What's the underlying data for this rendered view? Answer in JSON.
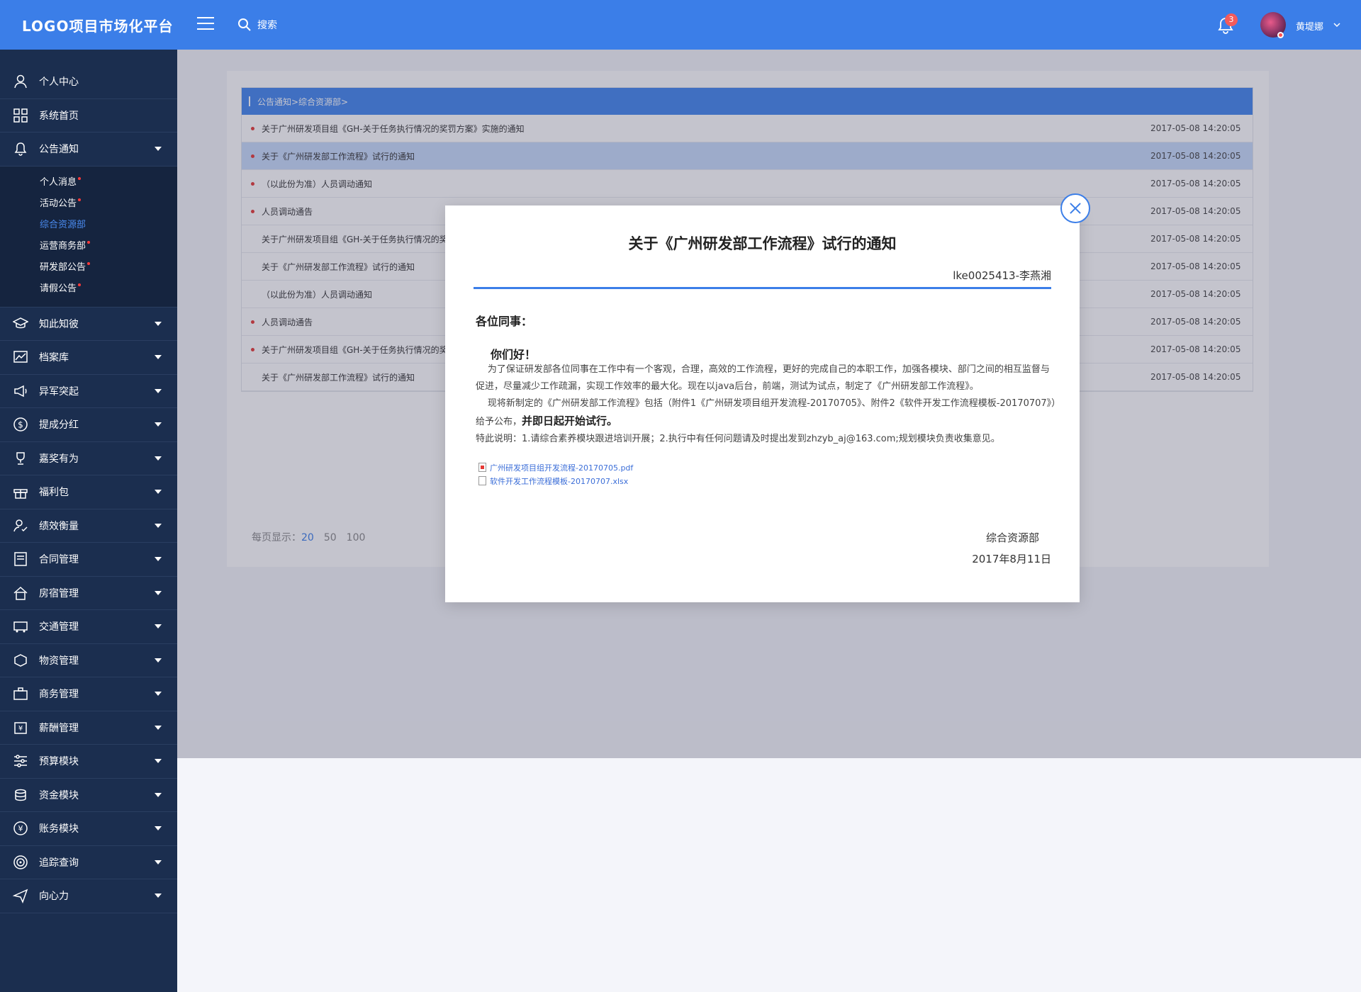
{
  "header": {
    "logo": "LOGO项目市场化平台",
    "search_label": "搜索",
    "notification_count": "3",
    "username": "黄堤娜"
  },
  "sidebar": {
    "items": [
      {
        "label": "个人中心",
        "icon": "user-icon"
      },
      {
        "label": "系统首页",
        "icon": "grid-icon"
      },
      {
        "label": "公告通知",
        "icon": "bell-icon",
        "expanded": true
      },
      {
        "label": "知此知彼",
        "icon": "graduation-cap-icon"
      },
      {
        "label": "档案库",
        "icon": "chart-icon"
      },
      {
        "label": "异军突起",
        "icon": "megaphone-icon"
      },
      {
        "label": "提成分红",
        "icon": "dollar-icon"
      },
      {
        "label": "嘉奖有为",
        "icon": "trophy-icon"
      },
      {
        "label": "福利包",
        "icon": "gift-icon"
      },
      {
        "label": "绩效衡量",
        "icon": "user-check-icon"
      },
      {
        "label": "合同管理",
        "icon": "contract-icon"
      },
      {
        "label": "房宿管理",
        "icon": "home-icon"
      },
      {
        "label": "交通管理",
        "icon": "bus-icon"
      },
      {
        "label": "物资管理",
        "icon": "box-icon"
      },
      {
        "label": "商务管理",
        "icon": "briefcase-icon"
      },
      {
        "label": "薪酬管理",
        "icon": "money-icon"
      },
      {
        "label": "预算模块",
        "icon": "sliders-icon"
      },
      {
        "label": "资金模块",
        "icon": "coins-icon"
      },
      {
        "label": "账务模块",
        "icon": "yen-icon"
      },
      {
        "label": "追踪查询",
        "icon": "target-icon"
      },
      {
        "label": "向心力",
        "icon": "send-icon"
      }
    ],
    "sub_items": [
      {
        "label": "个人消息",
        "dot": true,
        "active": false
      },
      {
        "label": "活动公告",
        "dot": true,
        "active": false
      },
      {
        "label": "综合资源部",
        "dot": false,
        "active": true
      },
      {
        "label": "运营商务部",
        "dot": true,
        "active": false
      },
      {
        "label": "研发部公告",
        "dot": true,
        "active": false
      },
      {
        "label": "请假公告",
        "dot": true,
        "active": false
      }
    ]
  },
  "list": {
    "breadcrumb": "公告通知>综合资源部>",
    "rows": [
      {
        "title": "关于广州研发项目组《GH-关于任务执行情况的奖罚方案》实施的通知",
        "date": "2017-05-08 14:20:05",
        "unread": true
      },
      {
        "title": "关于《广州研发部工作流程》试行的通知",
        "date": "2017-05-08 14:20:05",
        "unread": true,
        "selected": true
      },
      {
        "title": "（以此份为准）人员调动通知",
        "date": "2017-05-08 14:20:05",
        "unread": true
      },
      {
        "title": "人员调动通告",
        "date": "2017-05-08 14:20:05",
        "unread": true
      },
      {
        "title": "关于广州研发项目组《GH-关于任务执行情况的奖罚方案》实施的通知",
        "date": "2017-05-08 14:20:05",
        "unread": false
      },
      {
        "title": "关于《广州研发部工作流程》试行的通知",
        "date": "2017-05-08 14:20:05",
        "unread": false
      },
      {
        "title": "（以此份为准）人员调动通知",
        "date": "2017-05-08 14:20:05",
        "unread": false
      },
      {
        "title": "人员调动通告",
        "date": "2017-05-08 14:20:05",
        "unread": true
      },
      {
        "title": "关于广州研发项目组《GH-关于任务执行情况的奖罚方案》实施的通知",
        "date": "2017-05-08 14:20:05",
        "unread": true
      },
      {
        "title": "关于《广州研发部工作流程》试行的通知",
        "date": "2017-05-08 14:20:05",
        "unread": false
      }
    ],
    "page_size_label": "每页显示：",
    "page_sizes": [
      "20",
      "50",
      "100"
    ],
    "current_page_size": "20"
  },
  "modal": {
    "title": "关于《广州研发部工作流程》试行的通知",
    "author": "lke0025413-李燕湘",
    "greeting": "各位同事：",
    "hello": "你们好！",
    "para1": "为了保证研发部各位同事在工作中有一个客观，合理，高效的工作流程，更好的完成自己的本职工作，加强各模块、部门之间的相互监督与促进，尽量减少工作疏漏，实现工作效率的最大化。现在以java后台，前端，测试为试点，制定了《广州研发部工作流程》。",
    "para2_a": "现将新制定的《广州研发部工作流程》包括（附件1《广州研发项目组开发流程-20170705》、附件2《软件开发工作流程模板-20170707》）给予公布，",
    "para2_b": "并即日起开始试行。",
    "para3": "特此说明：1.请综合素养模块跟进培训开展；2.执行中有任何问题请及时提出发到zhzyb_aj@163.com;规划模块负责收集意见。",
    "attachments": [
      {
        "name": "广州研发项目组开发流程-20170705.pdf",
        "type": "pdf"
      },
      {
        "name": "软件开发工作流程模板-20170707.xlsx",
        "type": "xlsx"
      }
    ],
    "department": "综合资源部",
    "date": "2017年8月11日"
  },
  "colors": {
    "primary": "#3b7ee8",
    "sidebar": "#1b2e4f",
    "unread_dot": "#e53935"
  }
}
